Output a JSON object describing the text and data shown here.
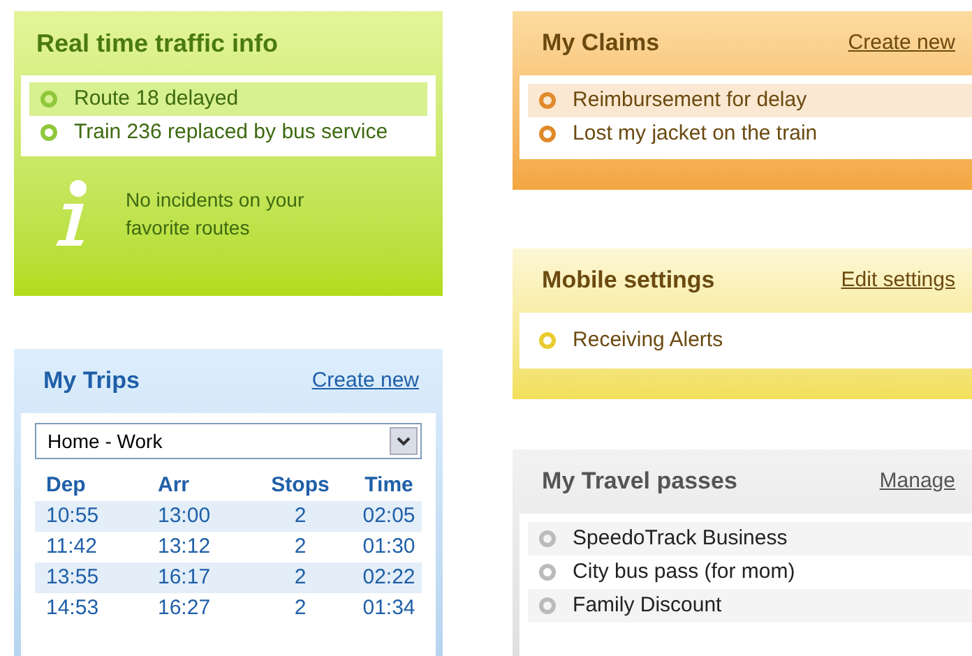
{
  "traffic": {
    "title": "Real time traffic info",
    "items": [
      {
        "text": "Route 18 delayed",
        "selected": true
      },
      {
        "text": "Train 236 replaced by bus service",
        "selected": false
      }
    ],
    "note": "No incidents on your favorite routes"
  },
  "claims": {
    "title": "My Claims",
    "link": "Create new",
    "items": [
      {
        "text": "Reimbursement for delay",
        "selected": true
      },
      {
        "text": "Lost my jacket on the train",
        "selected": false
      }
    ]
  },
  "mobile": {
    "title": "Mobile settings",
    "link": "Edit settings",
    "items": [
      {
        "text": "Receiving Alerts",
        "selected": false
      }
    ]
  },
  "trips": {
    "title": "My Trips",
    "link": "Create new",
    "route": "Home - Work",
    "columns": [
      "Dep",
      "Arr",
      "Stops",
      "Time"
    ],
    "rows": [
      [
        "10:55",
        "13:00",
        "2",
        "02:05"
      ],
      [
        "11:42",
        "13:12",
        "2",
        "01:30"
      ],
      [
        "13:55",
        "16:17",
        "2",
        "02:22"
      ],
      [
        "14:53",
        "16:27",
        "2",
        "01:34"
      ]
    ]
  },
  "passes": {
    "title": "My Travel passes",
    "link": "Manage",
    "items": [
      {
        "text": "SpeedoTrack Business",
        "selected": false
      },
      {
        "text": "City bus pass (for mom)",
        "selected": false
      },
      {
        "text": "Family Discount",
        "selected": false
      }
    ]
  }
}
